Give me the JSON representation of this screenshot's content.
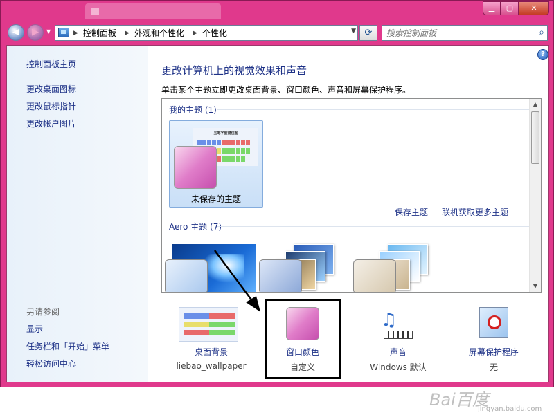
{
  "breadcrumb": [
    "控制面板",
    "外观和个性化",
    "个性化"
  ],
  "search": {
    "placeholder": "搜索控制面板"
  },
  "left_nav": {
    "home": "控制面板主页",
    "links": [
      "更改桌面图标",
      "更改鼠标指针",
      "更改帐户图片"
    ],
    "see_also_header": "另请参阅",
    "see_also_links": [
      "显示",
      "任务栏和「开始」菜单",
      "轻松访问中心"
    ]
  },
  "main": {
    "title": "更改计算机上的视觉效果和声音",
    "description": "单击某个主题立即更改桌面背景、窗口颜色、声音和屏幕保护程序。",
    "my_themes_header": "我的主题 (1)",
    "unsaved_theme": "未保存的主题",
    "save_theme_link": "保存主题",
    "more_themes_link": "联机获取更多主题",
    "aero_header": "Aero 主题 (7)"
  },
  "wallpaper_title_text": "五笔字型键位图",
  "bottom": [
    {
      "label": "桌面背景",
      "value": "liebao_wallpaper"
    },
    {
      "label": "窗口颜色",
      "value": "自定义"
    },
    {
      "label": "声音",
      "value": "Windows 默认"
    },
    {
      "label": "屏幕保护程序",
      "value": "无"
    }
  ],
  "watermark": {
    "logo": "Bai百度",
    "url": "jingyan.baidu.com"
  },
  "colors": {
    "window_frame": "#e0398c",
    "link": "#1e3287",
    "window_color_swatch": "#e07dc9"
  }
}
